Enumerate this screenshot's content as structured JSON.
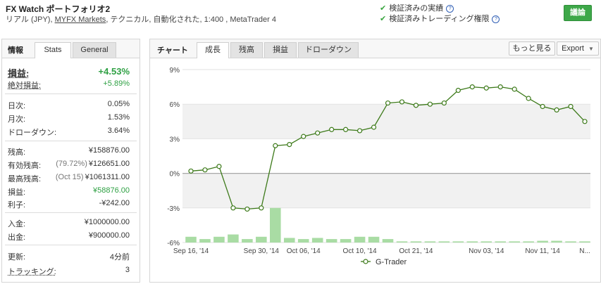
{
  "header": {
    "title": "FX Watch ポートフォリオ2",
    "sub_prefix": "リアル (JPY),",
    "sub_link": "MYFX Markets",
    "sub_suffix": ", テクニカル, 自動化された, 1:400 , MetaTrader 4",
    "verified1": "検証済みの実績",
    "verified2": "検証済みトレーディング権限",
    "help_glyph": "?",
    "check_glyph": "✔",
    "discuss_label": "議論"
  },
  "left": {
    "section_label": "情報",
    "tab_stats": "Stats",
    "tab_general": "General",
    "gain_label": "損益:",
    "gain_value": "+4.53%",
    "abs_gain_label": "絶対損益:",
    "abs_gain_value": "+5.89%",
    "daily_label": "日次:",
    "daily_value": "0.05%",
    "monthly_label": "月次:",
    "monthly_value": "1.53%",
    "drawdown_label": "ドローダウン:",
    "drawdown_value": "3.64%",
    "balance_label": "残高:",
    "balance_value": "¥158876.00",
    "equity_label": "有効残高:",
    "equity_note": "(79.72%)",
    "equity_value": "¥126651.00",
    "highest_label": "最高残高:",
    "highest_note": "(Oct 15)",
    "highest_value": "¥1061311.00",
    "profit_label": "損益:",
    "profit_value": "¥58876.00",
    "interest_label": "利子:",
    "interest_value": "-¥242.00",
    "deposits_label": "入金:",
    "deposits_value": "¥1000000.00",
    "withdrawals_label": "出金:",
    "withdrawals_value": "¥900000.00",
    "updated_label": "更新:",
    "updated_value": "4分前",
    "tracking_label": "トラッキング:",
    "tracking_value": "3"
  },
  "right": {
    "section_label": "チャート",
    "tabs": [
      "成長",
      "残高",
      "損益",
      "ドローダウン"
    ],
    "more_label": "もっと見る",
    "export_label": "Export",
    "caret_glyph": "▼"
  },
  "colors": {
    "gain_green": "#2ea043",
    "line_green": "#3d7a1a",
    "bar_green": "#a9dca4",
    "discuss_bg": "#3ea849"
  },
  "chart_data": {
    "type": "line",
    "ylim": [
      -6,
      9
    ],
    "yticks": [
      9,
      6,
      3,
      0,
      -3,
      -6
    ],
    "ytick_labels": [
      "9%",
      "6%",
      "3%",
      "0%",
      "-3%",
      "-6%"
    ],
    "xtick_labels": [
      "Sep 16, '14",
      "Sep 30, '14",
      "Oct 06, '14",
      "Oct 10, '14",
      "Oct 21, '14",
      "Nov 03, '14",
      "Nov 11, '14",
      "N..."
    ],
    "xtick_index": [
      0,
      5,
      8,
      12,
      16,
      21,
      25,
      28
    ],
    "series": [
      {
        "name": "G-Trader",
        "values": [
          0.2,
          0.3,
          0.6,
          -3.0,
          -3.1,
          -3.0,
          2.4,
          2.5,
          3.2,
          3.5,
          3.8,
          3.8,
          3.7,
          4.0,
          6.1,
          6.2,
          5.9,
          6.0,
          6.1,
          7.2,
          7.5,
          7.4,
          7.5,
          7.3,
          6.5,
          5.8,
          5.5,
          5.8,
          4.5
        ]
      }
    ],
    "bars": [
      -5.5,
      -5.7,
      -5.5,
      -5.3,
      -5.7,
      -5.5,
      -3.0,
      -5.6,
      -5.7,
      -5.6,
      -5.7,
      -5.7,
      -5.5,
      -5.5,
      -5.7,
      -5.9,
      -5.9,
      -5.9,
      -5.9,
      -5.9,
      -5.9,
      -5.9,
      -5.9,
      -5.9,
      -5.9,
      -5.85,
      -5.85,
      -5.9,
      -5.9
    ],
    "legend": "bottom",
    "grid": true
  }
}
